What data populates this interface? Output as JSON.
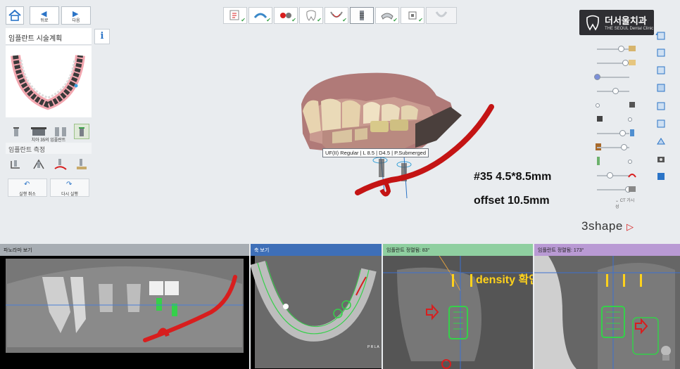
{
  "nav": {
    "back_label": "뒤로",
    "next_label": "다음"
  },
  "left_panel": {
    "title": "임플란트 시술계획",
    "thumbnail_caption": "치아 35의 임플란트",
    "section_measure": "임플란트 측정",
    "undo_label": "실행 취소",
    "redo_label": "다시 실행"
  },
  "logo": {
    "korean": "더서울치과",
    "english": "THE SEOUL Dental Clinic"
  },
  "viewport": {
    "implant_label": "UF(II) Regular | L 8.5 | D4.5 | P.Submerged",
    "annotation_size": "#35  4.5*8.5mm",
    "annotation_offset": "offset 10.5mm",
    "brand": "3shape",
    "ct_label": "CT 가시성"
  },
  "panes": {
    "panorama": {
      "title": "파노라마 보기"
    },
    "axial": {
      "title": "축 보기"
    },
    "impl1": {
      "title": "임플란트 정렬됨: 83°",
      "note": "density 확인"
    },
    "impl2": {
      "title": "임플란트 정렬됨: 173°"
    }
  },
  "orientation_letters": {
    "p": "P",
    "r": "R",
    "l": "L",
    "a": "A"
  },
  "colors": {
    "accent_blue": "#2b74c7",
    "check_green": "#3aa14a",
    "nerve_red": "#d81e1e",
    "implant_green": "#35d04a",
    "note_yellow": "#ffd21c"
  }
}
